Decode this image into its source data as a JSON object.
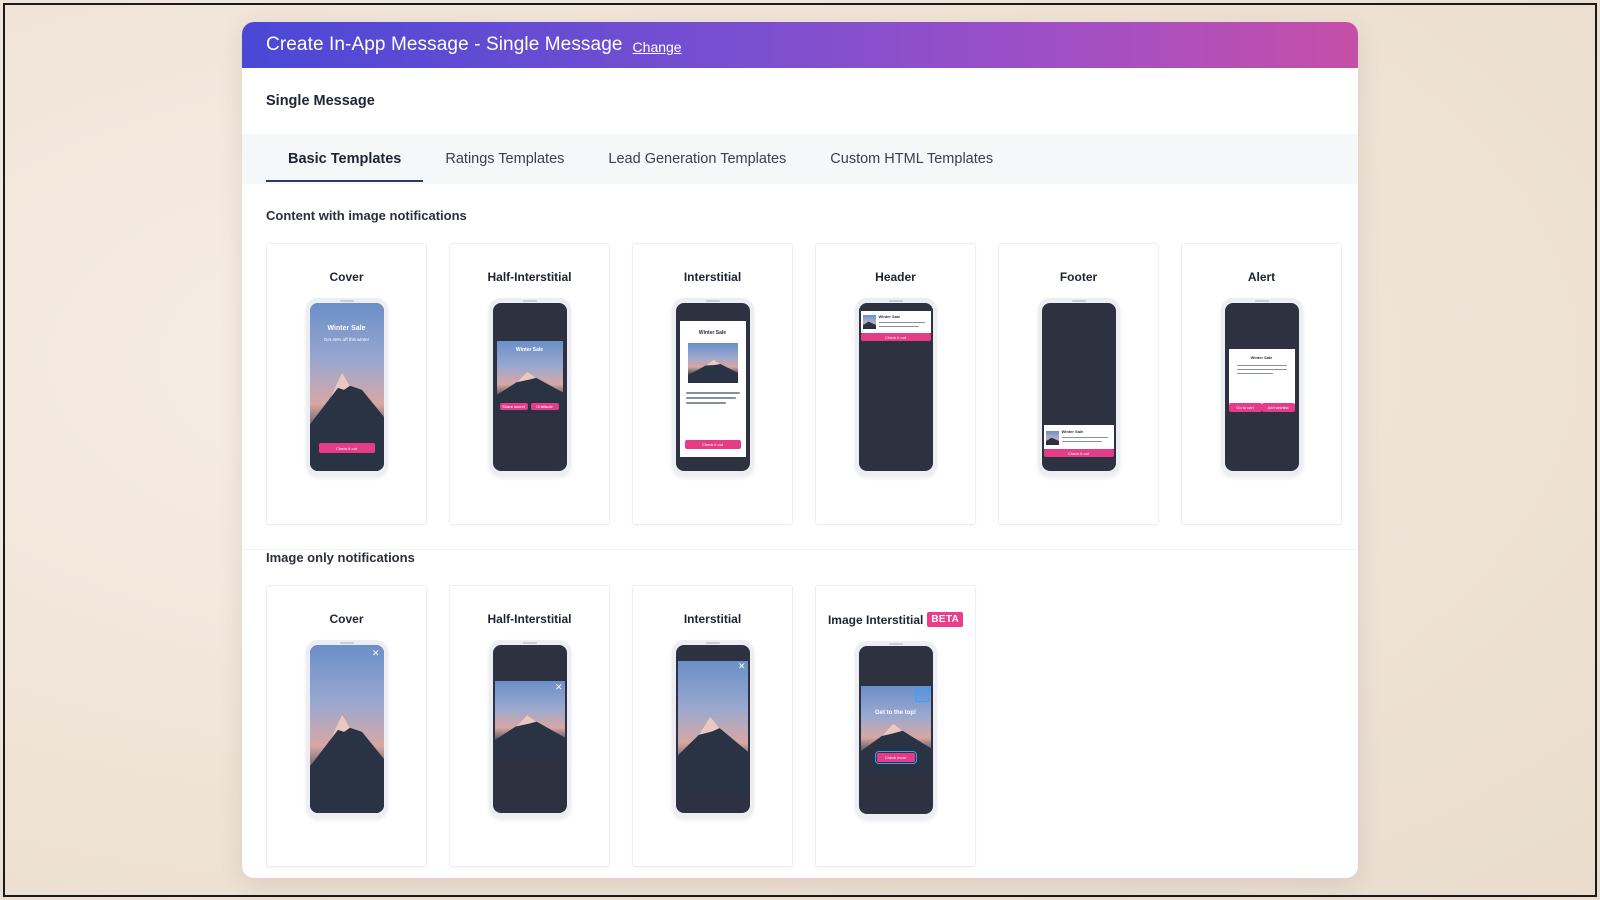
{
  "header": {
    "title": "Create In-App Message - Single Message",
    "change_link": "Change"
  },
  "subheader": {
    "title": "Single Message"
  },
  "tabs": [
    {
      "label": "Basic Templates",
      "active": true
    },
    {
      "label": "Ratings Templates",
      "active": false
    },
    {
      "label": "Lead Generation Templates",
      "active": false
    },
    {
      "label": "Custom HTML Templates",
      "active": false
    }
  ],
  "sections": {
    "content_with_image": {
      "title": "Content with image notifications",
      "cards": [
        {
          "label": "Cover",
          "preview_title": "Winter Sale",
          "preview_subtitle": "Get 40% off this winter",
          "preview_button": "Check it out"
        },
        {
          "label": "Half-Interstitial",
          "preview_title": "Winter Sale",
          "preview_button_1": "Share secret",
          "preview_button_2": "Gratitude"
        },
        {
          "label": "Interstitial",
          "preview_title": "Winter Sale",
          "preview_button": "Check it out"
        },
        {
          "label": "Header",
          "preview_title": "Winter Sale",
          "preview_button": "Check it out"
        },
        {
          "label": "Footer",
          "preview_title": "Winter Sale",
          "preview_button": "Check it out"
        },
        {
          "label": "Alert",
          "preview_title": "Winter Sale",
          "preview_button_1": "Go to cart",
          "preview_button_2": "Add wishlist"
        }
      ]
    },
    "image_only": {
      "title": "Image only notifications",
      "cards": [
        {
          "label": "Cover"
        },
        {
          "label": "Half-Interstitial"
        },
        {
          "label": "Interstitial"
        },
        {
          "label": "Image Interstitial",
          "badge": "BETA",
          "preview_title": "Get to the top!",
          "preview_button": "Check more"
        }
      ]
    }
  },
  "colors": {
    "header_start": "#4a48d6",
    "header_end": "#c64fa8",
    "accent_pink": "#e43c86",
    "phone_screen": "#2d3140"
  },
  "icons": {
    "close": "close-icon"
  }
}
